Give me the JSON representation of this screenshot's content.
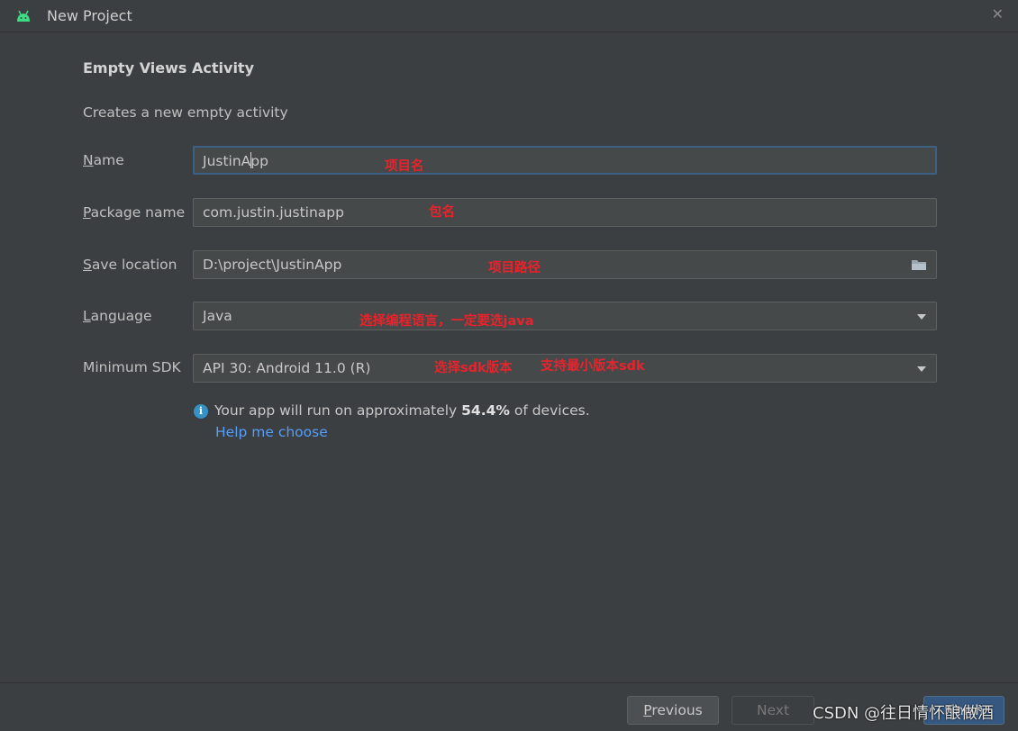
{
  "window": {
    "title": "New Project",
    "close_glyph": "✕"
  },
  "template": {
    "heading": "Empty Views Activity",
    "description": "Creates a new empty activity"
  },
  "form": {
    "name": {
      "label_mnemonic": "N",
      "label_rest": "ame",
      "value_before_caret": "JustinA",
      "value_after_caret": "pp"
    },
    "package": {
      "label_mnemonic": "P",
      "label_rest": "ackage name",
      "value": "com.justin.justinapp"
    },
    "save_location": {
      "label_mnemonic": "S",
      "label_rest": "ave location",
      "value": "D:\\project\\JustinApp",
      "icon": "folder-icon"
    },
    "language": {
      "label_mnemonic": "L",
      "label_rest": "anguage",
      "value": "Java"
    },
    "min_sdk": {
      "label": "Minimum SDK",
      "value": "API 30: Android 11.0 (R)"
    }
  },
  "annotations": {
    "name": "项目名",
    "package": "包名",
    "location": "项目路径",
    "language": "选择编程语言，一定要选java",
    "sdk_select": "选择sdk版本",
    "sdk_min": "支持最小版本sdk"
  },
  "info": {
    "icon": "i",
    "text_before": "Your app will run on approximately ",
    "percent": "54.4%",
    "text_after": " of devices.",
    "help_link": "Help me choose"
  },
  "footer": {
    "previous_mnemonic": "P",
    "previous_rest": "revious",
    "next": "Next",
    "finish": "Finish"
  },
  "watermark": "CSDN @往日情怀酿做酒",
  "colors": {
    "background": "#3c3f41",
    "field": "#45494a",
    "focus_border": "#3d6185",
    "link": "#589df6",
    "annotation": "#e8232b",
    "info_icon": "#3592c4"
  }
}
